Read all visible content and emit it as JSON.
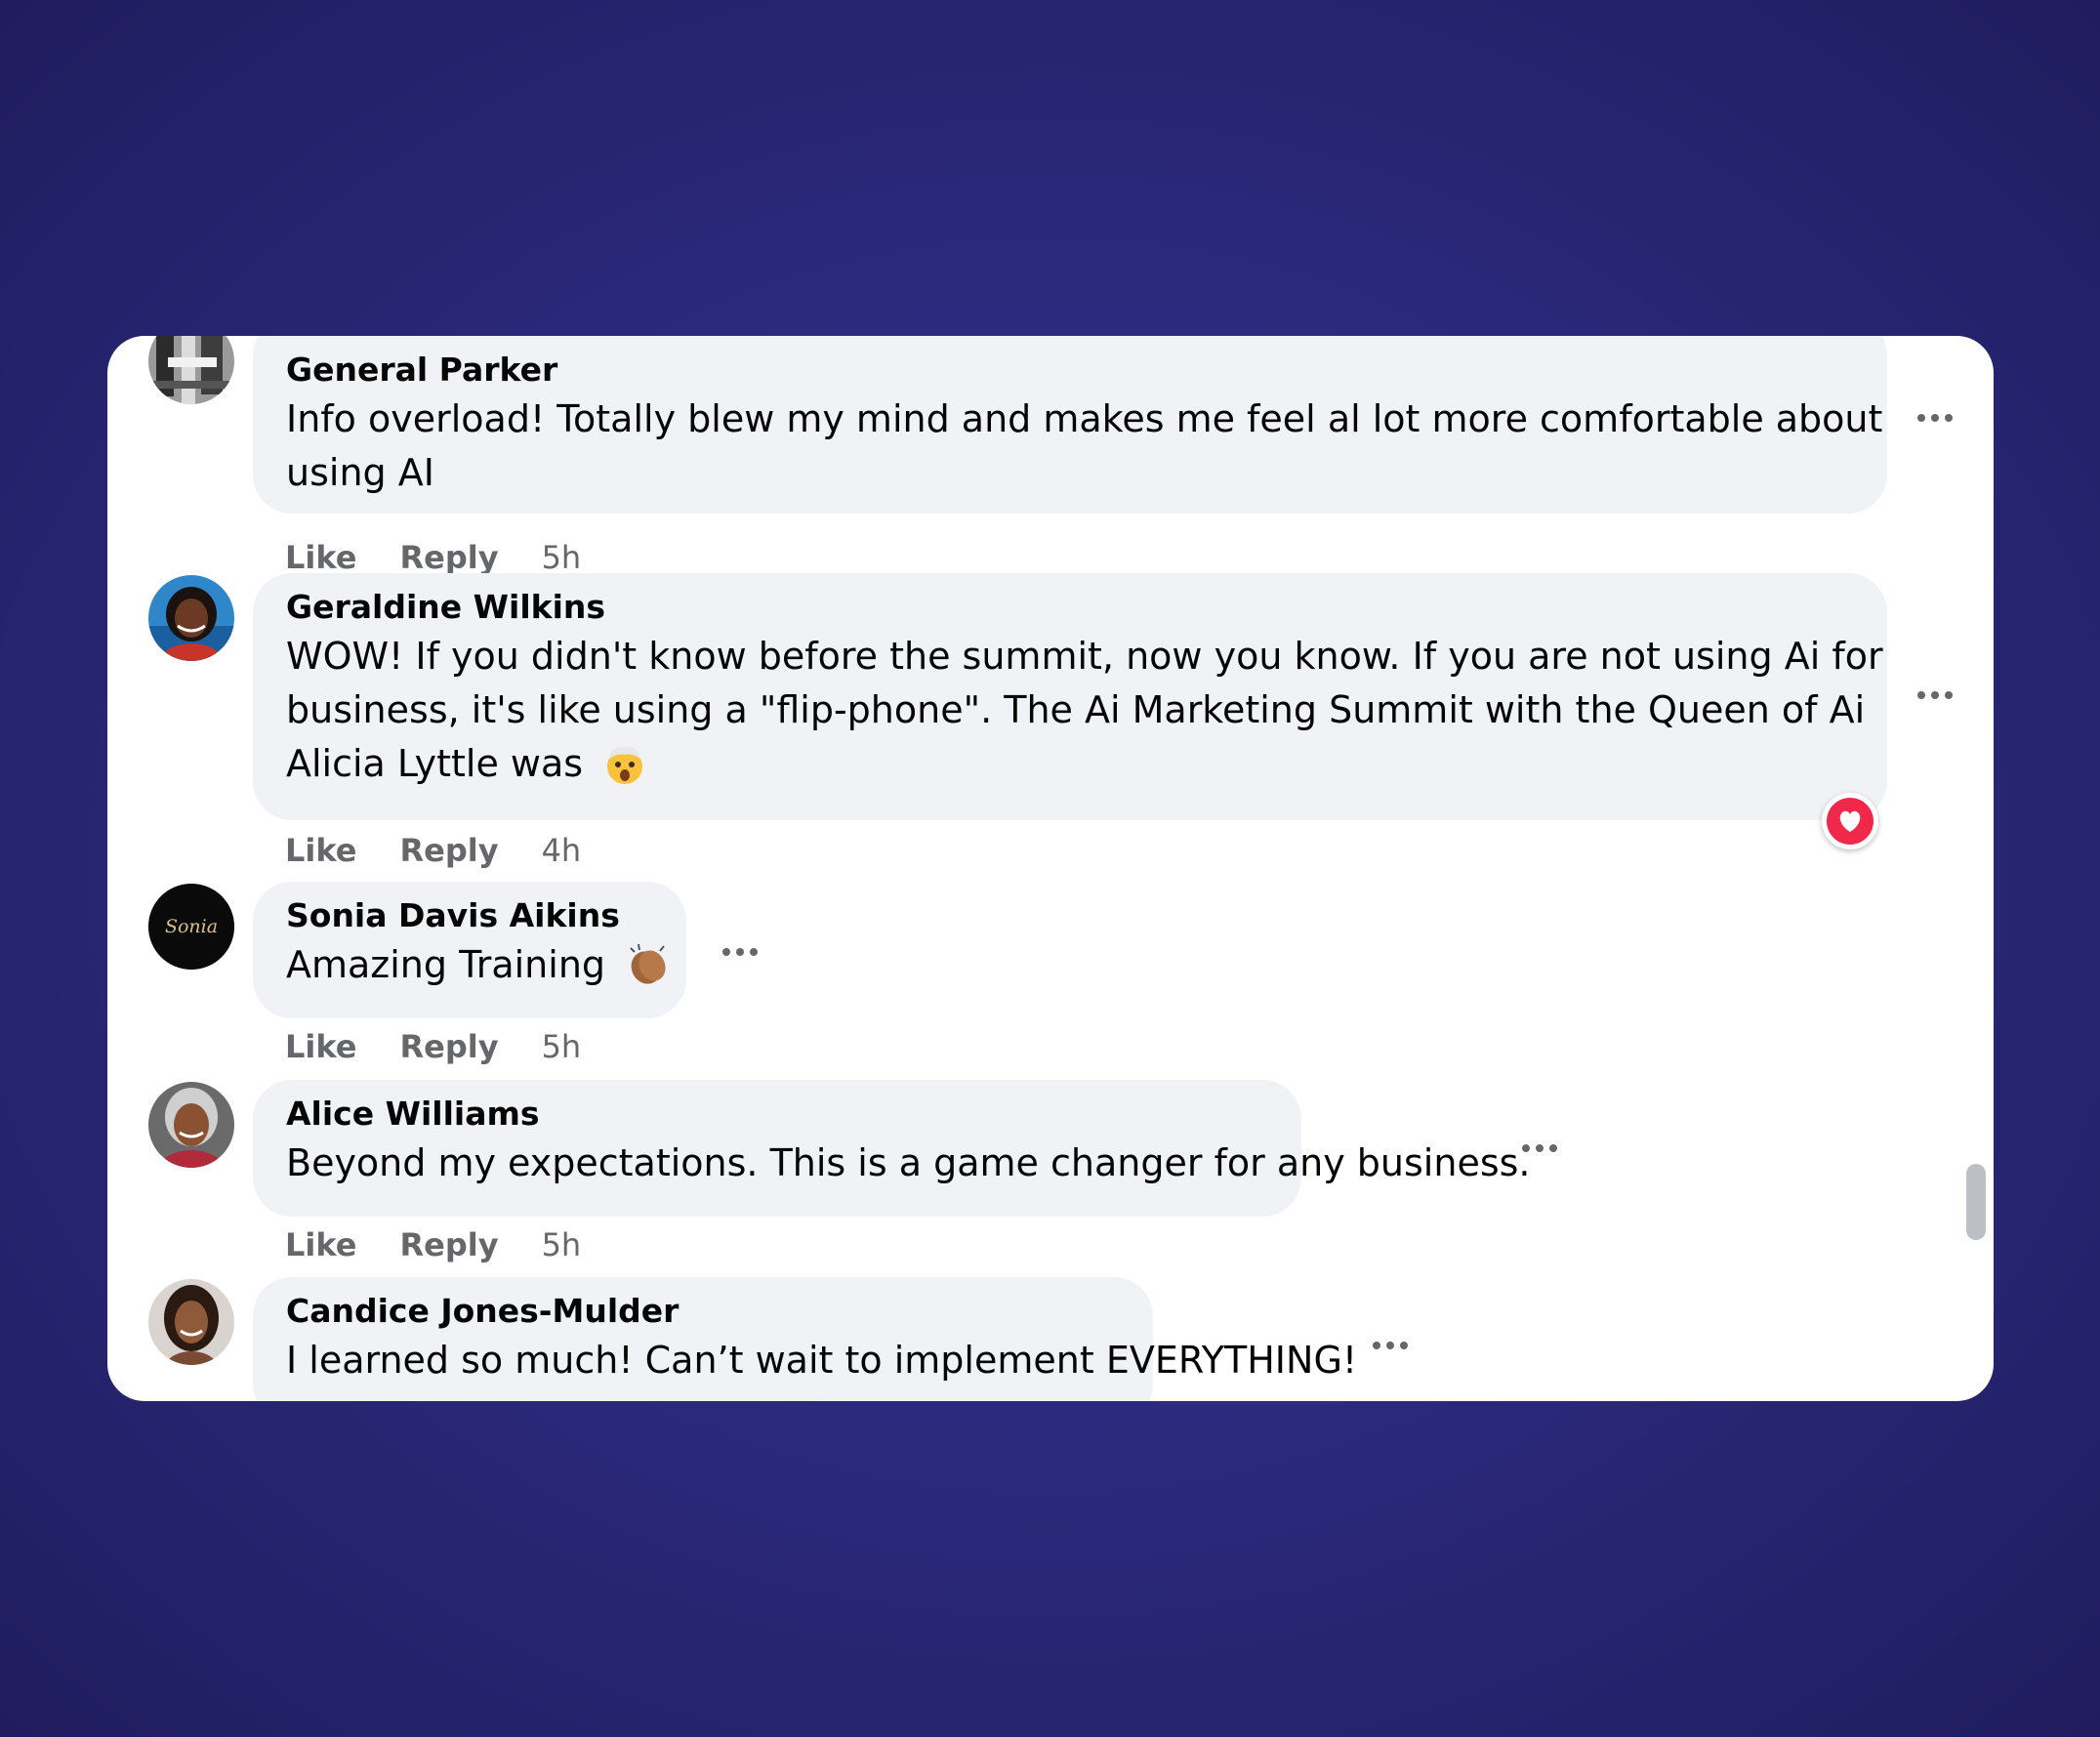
{
  "comments": [
    {
      "author": "General Parker",
      "lines": [
        "Info overload! Totally blew my mind and makes me feel al lot more comfortable about",
        "using AI"
      ],
      "like_label": "Like",
      "reply_label": "Reply",
      "time": "5h"
    },
    {
      "author": "Geraldine Wilkins",
      "lines": [
        "WOW! If you didn't know before the summit, now you know. If you are not using Ai for",
        "business, it's like using a \"flip-phone\". The Ai Marketing Summit with the Queen of Ai",
        "Alicia Lyttle was"
      ],
      "emoji": "exploding-head-emoji",
      "reaction": "heart-reaction",
      "like_label": "Like",
      "reply_label": "Reply",
      "time": "4h"
    },
    {
      "author": "Sonia Davis Aikins",
      "lines": [
        "Amazing Training"
      ],
      "emoji": "clapping-hands-emoji",
      "avatar_text": "Sonia",
      "like_label": "Like",
      "reply_label": "Reply",
      "time": "5h"
    },
    {
      "author": "Alice Williams",
      "lines": [
        "Beyond my expectations. This is a game changer for any business."
      ],
      "like_label": "Like",
      "reply_label": "Reply",
      "time": "5h"
    },
    {
      "author": "Candice Jones-Mulder",
      "lines": [
        "I learned so much! Can’t wait to implement EVERYTHING!"
      ]
    }
  ],
  "colors": {
    "background": "#2c2a7e",
    "bubble": "#f0f2f5",
    "meta_text": "#65676b",
    "heart": "#f0284a"
  }
}
